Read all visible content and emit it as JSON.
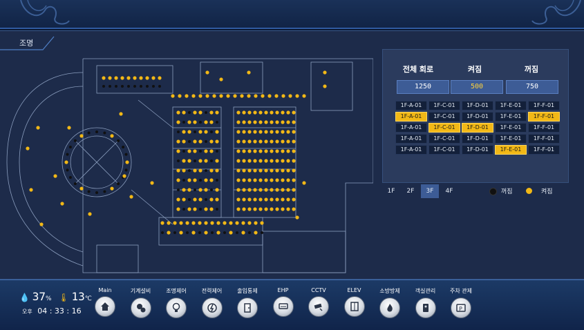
{
  "section_title": "조명",
  "summary": {
    "headers": [
      "전체 회로",
      "켜짐",
      "꺼짐"
    ],
    "values": {
      "total": "1250",
      "on": "500",
      "off": "750"
    }
  },
  "circuits": [
    [
      {
        "id": "1F-A-01",
        "lit": false
      },
      {
        "id": "1F-C-01",
        "lit": false
      },
      {
        "id": "1F-D-01",
        "lit": false
      },
      {
        "id": "1F-E-01",
        "lit": false
      },
      {
        "id": "1F-F-01",
        "lit": false
      }
    ],
    [
      {
        "id": "1F-A-01",
        "lit": true
      },
      {
        "id": "1F-C-01",
        "lit": false
      },
      {
        "id": "1F-D-01",
        "lit": false
      },
      {
        "id": "1F-E-01",
        "lit": false
      },
      {
        "id": "1F-F-01",
        "lit": true
      }
    ],
    [
      {
        "id": "1F-A-01",
        "lit": false
      },
      {
        "id": "1F-C-01",
        "lit": true
      },
      {
        "id": "1F-D-01",
        "lit": true
      },
      {
        "id": "1F-E-01",
        "lit": false
      },
      {
        "id": "1F-F-01",
        "lit": false
      }
    ],
    [
      {
        "id": "1F-A-01",
        "lit": false
      },
      {
        "id": "1F-C-01",
        "lit": false
      },
      {
        "id": "1F-D-01",
        "lit": false
      },
      {
        "id": "1F-E-01",
        "lit": false
      },
      {
        "id": "1F-F-01",
        "lit": false
      }
    ],
    [
      {
        "id": "1F-A-01",
        "lit": false
      },
      {
        "id": "1F-C-01",
        "lit": false
      },
      {
        "id": "1F-D-01",
        "lit": false
      },
      {
        "id": "1F-E-01",
        "lit": true
      },
      {
        "id": "1F-F-01",
        "lit": false
      }
    ]
  ],
  "floors": [
    "1F",
    "2F",
    "3F",
    "4F"
  ],
  "active_floor": "3F",
  "legend": {
    "off": "꺼짐",
    "on": "켜짐"
  },
  "colors": {
    "lit": "#f2b816",
    "unlit": "#13203a",
    "on_dot": "#f2b816",
    "off_dot": "#111111"
  },
  "weather": {
    "humidity": "37",
    "humidity_unit": "%",
    "temperature": "13",
    "temperature_unit": "℃"
  },
  "clock": {
    "ampm": "오후",
    "time": "04 : 33 : 16"
  },
  "nav": [
    {
      "label": "Main",
      "icon": "home-icon"
    },
    {
      "label": "기계설비",
      "icon": "gears-icon"
    },
    {
      "label": "조명제어",
      "icon": "bulb-icon"
    },
    {
      "label": "전력제어",
      "icon": "power-icon"
    },
    {
      "label": "출입통제",
      "icon": "door-icon"
    },
    {
      "label": "EHP",
      "icon": "aircon-icon"
    },
    {
      "label": "CCTV",
      "icon": "cctv-icon"
    },
    {
      "label": "ELEV",
      "icon": "elevator-icon"
    },
    {
      "label": "소방방제",
      "icon": "fire-icon"
    },
    {
      "label": "객실관리",
      "icon": "room-key-icon"
    },
    {
      "label": "주차 관제",
      "icon": "parking-icon"
    }
  ]
}
